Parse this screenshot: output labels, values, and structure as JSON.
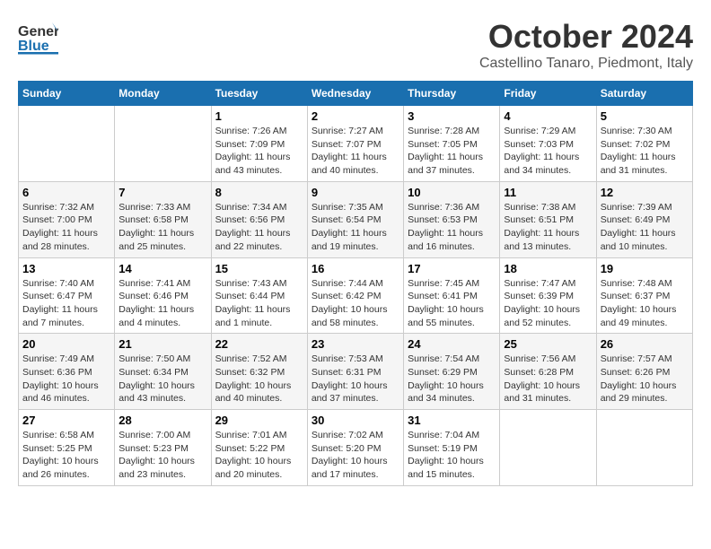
{
  "header": {
    "logo": {
      "line1": "General",
      "line2": "Blue"
    },
    "title": "October 2024",
    "location": "Castellino Tanaro, Piedmont, Italy"
  },
  "weekdays": [
    "Sunday",
    "Monday",
    "Tuesday",
    "Wednesday",
    "Thursday",
    "Friday",
    "Saturday"
  ],
  "weeks": [
    [
      {
        "day": "",
        "info": ""
      },
      {
        "day": "",
        "info": ""
      },
      {
        "day": "1",
        "info": "Sunrise: 7:26 AM\nSunset: 7:09 PM\nDaylight: 11 hours and 43 minutes."
      },
      {
        "day": "2",
        "info": "Sunrise: 7:27 AM\nSunset: 7:07 PM\nDaylight: 11 hours and 40 minutes."
      },
      {
        "day": "3",
        "info": "Sunrise: 7:28 AM\nSunset: 7:05 PM\nDaylight: 11 hours and 37 minutes."
      },
      {
        "day": "4",
        "info": "Sunrise: 7:29 AM\nSunset: 7:03 PM\nDaylight: 11 hours and 34 minutes."
      },
      {
        "day": "5",
        "info": "Sunrise: 7:30 AM\nSunset: 7:02 PM\nDaylight: 11 hours and 31 minutes."
      }
    ],
    [
      {
        "day": "6",
        "info": "Sunrise: 7:32 AM\nSunset: 7:00 PM\nDaylight: 11 hours and 28 minutes."
      },
      {
        "day": "7",
        "info": "Sunrise: 7:33 AM\nSunset: 6:58 PM\nDaylight: 11 hours and 25 minutes."
      },
      {
        "day": "8",
        "info": "Sunrise: 7:34 AM\nSunset: 6:56 PM\nDaylight: 11 hours and 22 minutes."
      },
      {
        "day": "9",
        "info": "Sunrise: 7:35 AM\nSunset: 6:54 PM\nDaylight: 11 hours and 19 minutes."
      },
      {
        "day": "10",
        "info": "Sunrise: 7:36 AM\nSunset: 6:53 PM\nDaylight: 11 hours and 16 minutes."
      },
      {
        "day": "11",
        "info": "Sunrise: 7:38 AM\nSunset: 6:51 PM\nDaylight: 11 hours and 13 minutes."
      },
      {
        "day": "12",
        "info": "Sunrise: 7:39 AM\nSunset: 6:49 PM\nDaylight: 11 hours and 10 minutes."
      }
    ],
    [
      {
        "day": "13",
        "info": "Sunrise: 7:40 AM\nSunset: 6:47 PM\nDaylight: 11 hours and 7 minutes."
      },
      {
        "day": "14",
        "info": "Sunrise: 7:41 AM\nSunset: 6:46 PM\nDaylight: 11 hours and 4 minutes."
      },
      {
        "day": "15",
        "info": "Sunrise: 7:43 AM\nSunset: 6:44 PM\nDaylight: 11 hours and 1 minute."
      },
      {
        "day": "16",
        "info": "Sunrise: 7:44 AM\nSunset: 6:42 PM\nDaylight: 10 hours and 58 minutes."
      },
      {
        "day": "17",
        "info": "Sunrise: 7:45 AM\nSunset: 6:41 PM\nDaylight: 10 hours and 55 minutes."
      },
      {
        "day": "18",
        "info": "Sunrise: 7:47 AM\nSunset: 6:39 PM\nDaylight: 10 hours and 52 minutes."
      },
      {
        "day": "19",
        "info": "Sunrise: 7:48 AM\nSunset: 6:37 PM\nDaylight: 10 hours and 49 minutes."
      }
    ],
    [
      {
        "day": "20",
        "info": "Sunrise: 7:49 AM\nSunset: 6:36 PM\nDaylight: 10 hours and 46 minutes."
      },
      {
        "day": "21",
        "info": "Sunrise: 7:50 AM\nSunset: 6:34 PM\nDaylight: 10 hours and 43 minutes."
      },
      {
        "day": "22",
        "info": "Sunrise: 7:52 AM\nSunset: 6:32 PM\nDaylight: 10 hours and 40 minutes."
      },
      {
        "day": "23",
        "info": "Sunrise: 7:53 AM\nSunset: 6:31 PM\nDaylight: 10 hours and 37 minutes."
      },
      {
        "day": "24",
        "info": "Sunrise: 7:54 AM\nSunset: 6:29 PM\nDaylight: 10 hours and 34 minutes."
      },
      {
        "day": "25",
        "info": "Sunrise: 7:56 AM\nSunset: 6:28 PM\nDaylight: 10 hours and 31 minutes."
      },
      {
        "day": "26",
        "info": "Sunrise: 7:57 AM\nSunset: 6:26 PM\nDaylight: 10 hours and 29 minutes."
      }
    ],
    [
      {
        "day": "27",
        "info": "Sunrise: 6:58 AM\nSunset: 5:25 PM\nDaylight: 10 hours and 26 minutes."
      },
      {
        "day": "28",
        "info": "Sunrise: 7:00 AM\nSunset: 5:23 PM\nDaylight: 10 hours and 23 minutes."
      },
      {
        "day": "29",
        "info": "Sunrise: 7:01 AM\nSunset: 5:22 PM\nDaylight: 10 hours and 20 minutes."
      },
      {
        "day": "30",
        "info": "Sunrise: 7:02 AM\nSunset: 5:20 PM\nDaylight: 10 hours and 17 minutes."
      },
      {
        "day": "31",
        "info": "Sunrise: 7:04 AM\nSunset: 5:19 PM\nDaylight: 10 hours and 15 minutes."
      },
      {
        "day": "",
        "info": ""
      },
      {
        "day": "",
        "info": ""
      }
    ]
  ]
}
